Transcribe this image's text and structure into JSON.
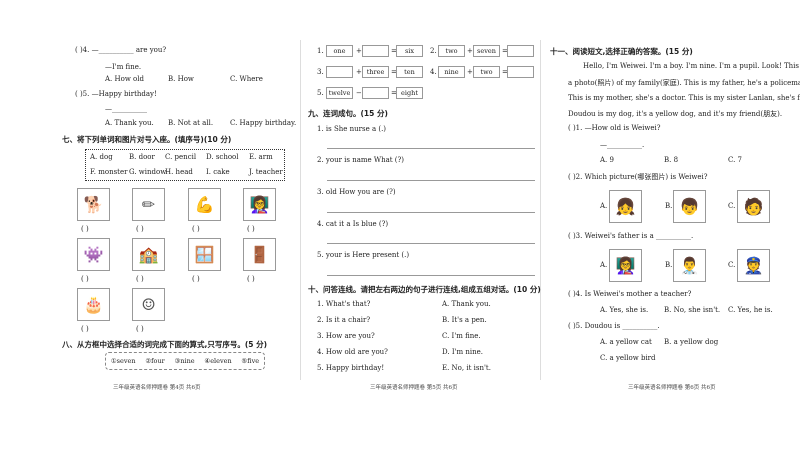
{
  "left": {
    "q4": "(      )4. —__________ are you?",
    "q4_reply": "—I'm fine.",
    "q4_opts": [
      "A. How old",
      "B. How",
      "C. Where"
    ],
    "q5": "(      )5. —Happy birthday!",
    "q5_reply": "—__________",
    "q5_opts": [
      "A. Thank you.",
      "B. Not at all.",
      "C. Happy birthday."
    ],
    "sec7_title": "七、将下列单词和图片对号入座。(填序号)(10 分)",
    "words": [
      "A. dog",
      "B. door",
      "C. pencil",
      "D. school",
      "E. arm",
      "F. monster",
      "G. window",
      "H. head",
      "I. cake",
      "J. teacher"
    ],
    "pictures": [
      "dog-picture",
      "pencil-picture",
      "arm-picture",
      "teacher-picture",
      "monster-picture",
      "school-picture",
      "window-picture",
      "door-picture",
      "cake-picture",
      "head-picture"
    ],
    "paren": "(        )",
    "sec8_title": "八、从方框中选择合适的词完成下面的算式,只写序号。(5 分)",
    "numbers": [
      "①seven",
      "②four",
      "③nine",
      "④eleven",
      "⑤five"
    ],
    "footer": "三年级英语名师押题卷  第4页  共6页"
  },
  "middle": {
    "equations": [
      {
        "n": "1.",
        "a": "one",
        "op": "+",
        "b": "",
        "r": "six"
      },
      {
        "n": "2.",
        "a": "two",
        "op": "+",
        "b": "seven",
        "r": ""
      },
      {
        "n": "3.",
        "a": "",
        "op": "+",
        "b": "three",
        "r": "ten"
      },
      {
        "n": "4.",
        "a": "nine",
        "op": "+",
        "b": "two",
        "r": ""
      },
      {
        "n": "5.",
        "a": "twelve",
        "op": "−",
        "b": "",
        "r": "eight"
      }
    ],
    "eq_sign": "=",
    "sec9_title": "九、连词成句。(15 分)",
    "sentences": [
      "1. is    She    nurse    a    (.)",
      "2. your    is    name    What    (?)",
      "3. old    How    you    are    (?)",
      "4. cat    it    a    Is    blue    (?)",
      "5. your    is    Here    present    (.)"
    ],
    "sec10_title": "十、问答连线。请把左右两边的句子进行连线,组成五组对话。(10 分)",
    "questions": [
      "1. What's that?",
      "2. Is it a chair?",
      "3. How are you?",
      "4. How old are you?",
      "5. Happy birthday!"
    ],
    "answers": [
      "A. Thank you.",
      "B. It's a pen.",
      "C. I'm fine.",
      "D. I'm nine.",
      "E. No, it isn't."
    ],
    "footer": "三年级英语名师押题卷  第5页  共6页"
  },
  "right": {
    "sec11_title": "十一、阅读短文,选择正确的答案。(15 分)",
    "passage": [
      "Hello, I'm Weiwei. I'm a boy. I'm nine. I'm a pupil. Look! This is",
      "a photo(照片) of my family(家庭). This is my father, he's a policeman.",
      "This is my mother, she's a doctor. This is my sister Lanlan, she's four.",
      "Doudou is my dog, it's a yellow dog, and it's my friend(朋友)."
    ],
    "q1": "(      )1. —How old is Weiwei?",
    "q1_reply": "—__________.",
    "q1_opts": [
      "A. 9",
      "B. 8",
      "C. 7"
    ],
    "q2": "(      )2. Which picture(哪张图片) is Weiwei?",
    "q2_opts": [
      "A.",
      "B.",
      "C."
    ],
    "q3": "(      )3. Weiwei's father is a __________.",
    "q3_opts": [
      "A.",
      "B.",
      "C."
    ],
    "q4": "(      )4. Is Weiwei's mother a teacher?",
    "q4_opts": [
      "A. Yes, she is.",
      "B. No, she isn't.",
      "C. Yes, he is."
    ],
    "q5": "(      )5. Doudou is __________.",
    "q5_opts": [
      "A. a yellow cat",
      "B. a yellow dog",
      "C. a yellow bird"
    ],
    "footer": "三年级英语名师押题卷  第6页  共6页"
  }
}
